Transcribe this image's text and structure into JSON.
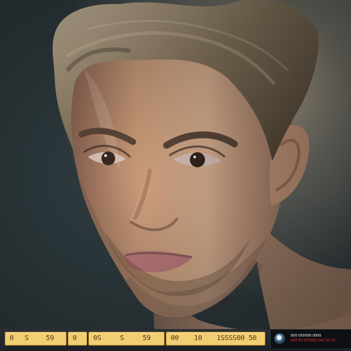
{
  "image": {
    "subject": "portrait-photo",
    "palette": {
      "background": "#3b4548",
      "skin": "#c79b78",
      "hair": "#7a6a54",
      "caption_bar": "#f2ce72",
      "badge": "#0d0f12",
      "badge_accent": "#e0322f"
    }
  },
  "caption_bar": {
    "cells": [
      {
        "texts": [
          "0",
          "S",
          "59"
        ]
      },
      {
        "texts": [
          "0"
        ]
      },
      {
        "texts": [
          "0S",
          "S",
          "59"
        ]
      },
      {
        "texts": [
          "00",
          "10",
          "1SSSS00 50"
        ]
      }
    ]
  },
  "badge": {
    "icon": "globe-icon",
    "line1": "000 000000 0000",
    "line2": "000 00 000000 000 00 00"
  }
}
